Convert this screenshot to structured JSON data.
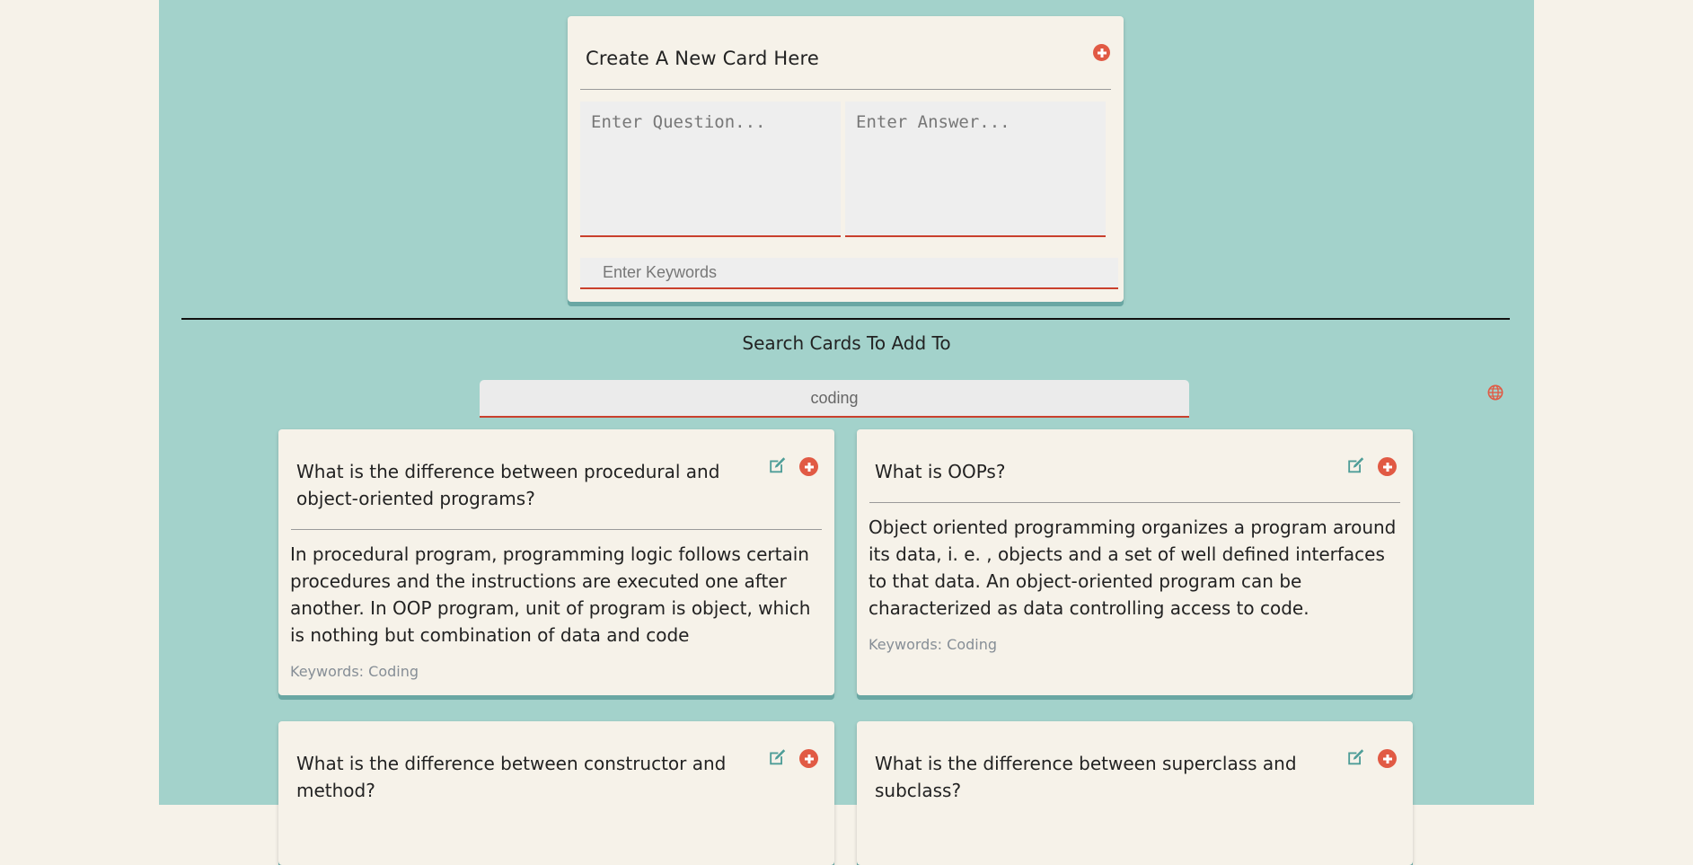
{
  "create": {
    "title": "Create A New Card Here",
    "question_placeholder": "Enter Question...",
    "answer_placeholder": "Enter Answer...",
    "keywords_placeholder": "Enter Keywords"
  },
  "search": {
    "title": "Search Cards To Add To",
    "value": "coding"
  },
  "cards": [
    {
      "question": "What is the difference between procedural and object-oriented programs?",
      "answer": "In procedural program, programming logic follows certain procedures and the instructions are executed one after another. In OOP program, unit of program is object, which is nothing but combination of data and code",
      "keywords": "Keywords: Coding"
    },
    {
      "question": "What is OOPs?",
      "answer": "Object oriented programming organizes a program around its data, i. e. , objects and a set of well defined interfaces to that data. An object-oriented program can be characterized as data controlling access to code.",
      "keywords": "Keywords: Coding"
    },
    {
      "question": "What is the difference between constructor and method?"
    },
    {
      "question": "What is the difference between superclass and subclass?"
    }
  ],
  "colors": {
    "background": "#f6f2e9",
    "panel": "#a3d2cb",
    "accent": "#e15a44",
    "edit_icon": "#4e9d98"
  }
}
